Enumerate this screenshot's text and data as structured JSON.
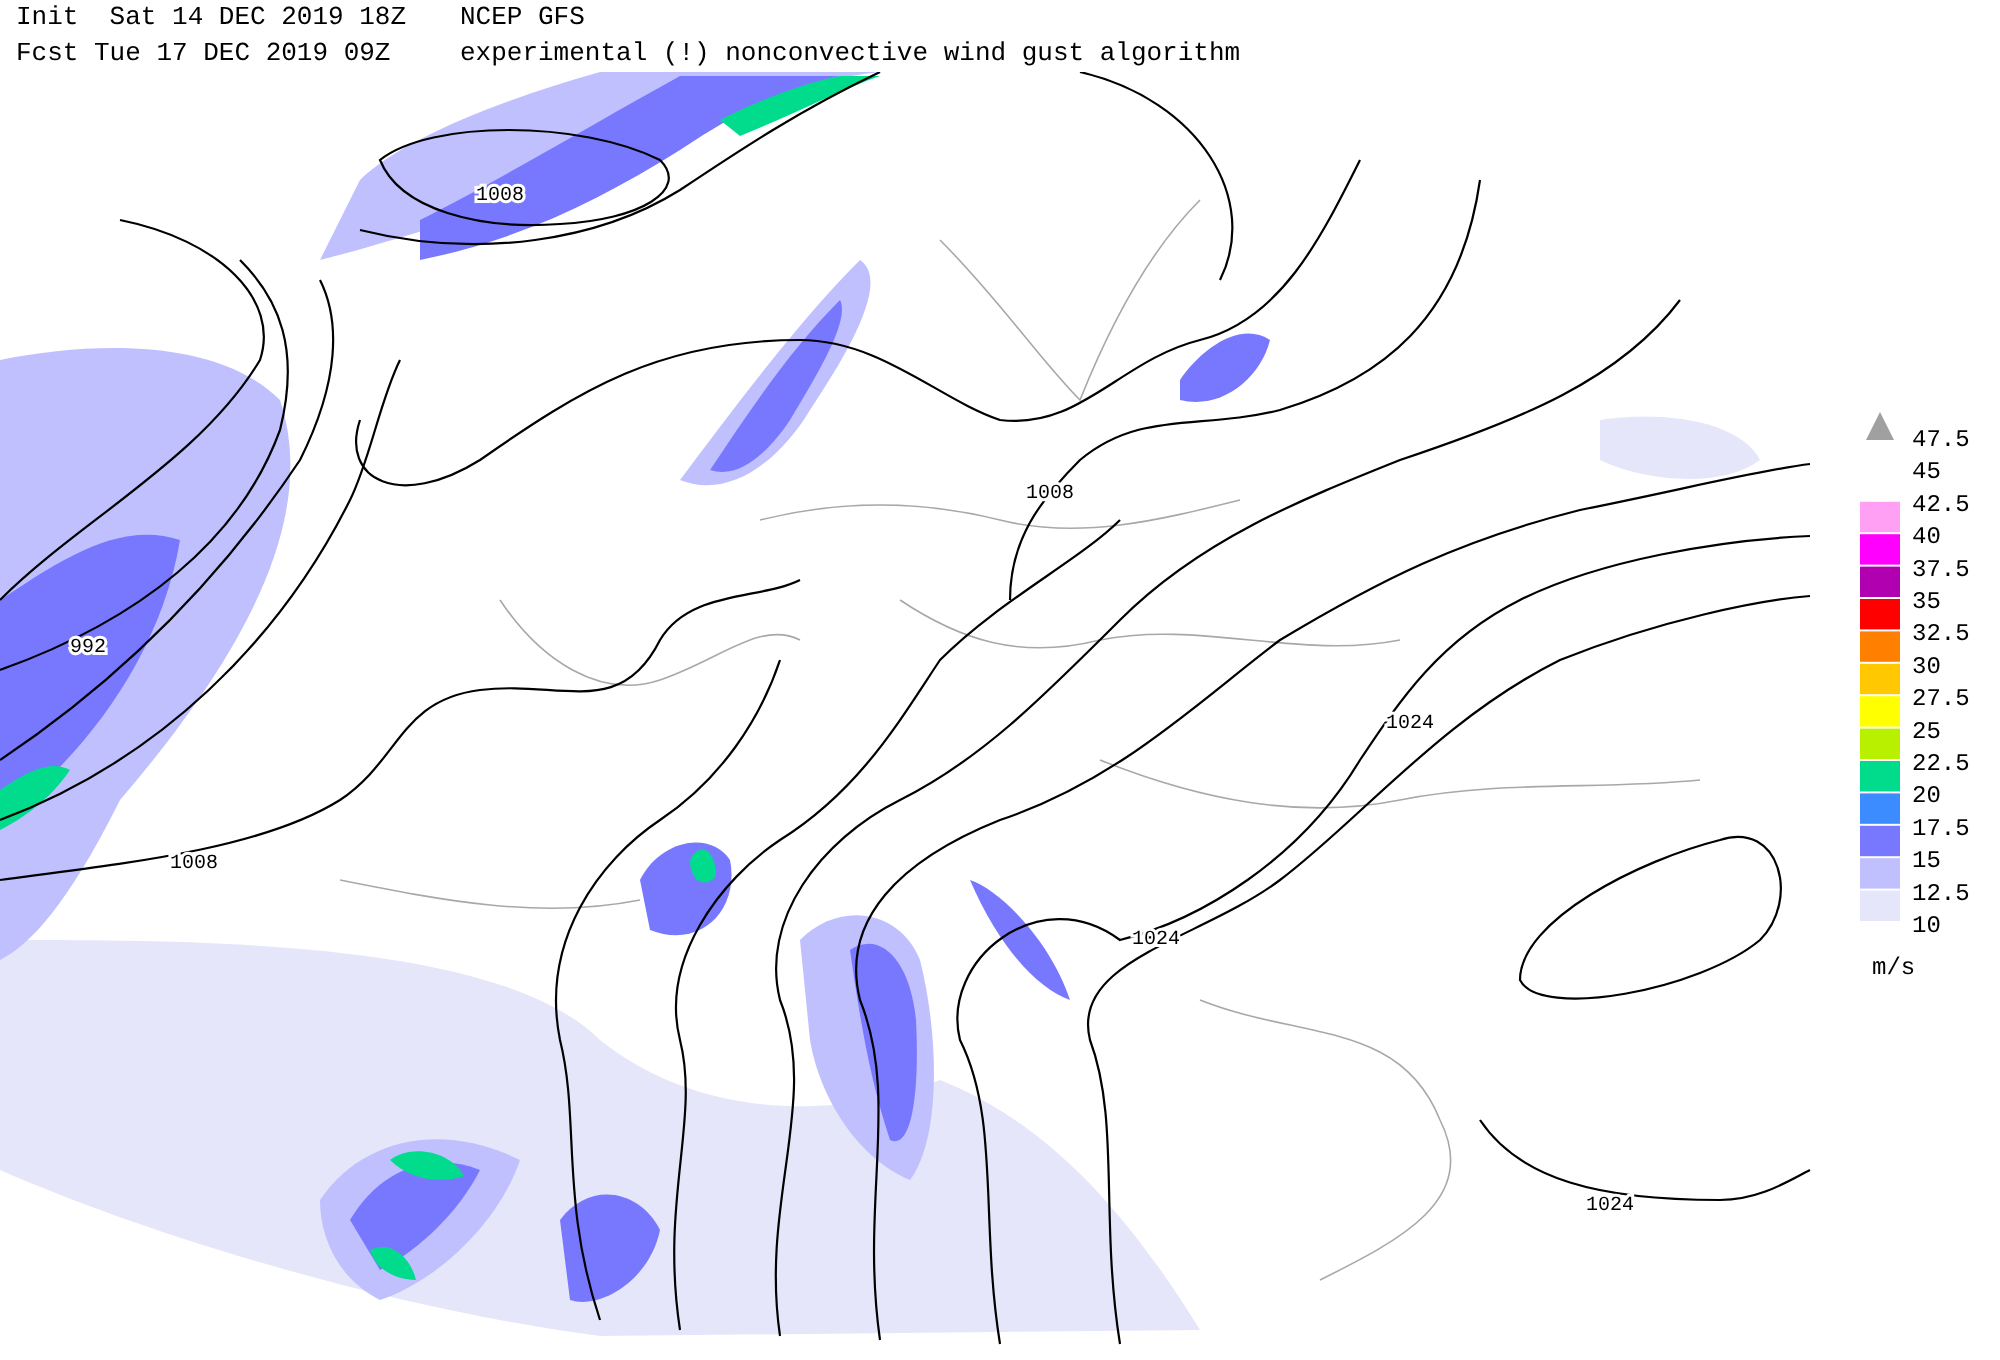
{
  "header": {
    "init": "Init  Sat 14 DEC 2019 18Z",
    "model": "NCEP GFS",
    "forecast": "Fcst Tue 17 DEC 2019 09Z",
    "product": "experimental (!) nonconvective wind gust algorithm"
  },
  "map": {
    "contour_labels": [
      "1008",
      "992",
      "1008",
      "1008",
      "1024",
      "1024",
      "1024"
    ]
  },
  "legend": {
    "labels": [
      "47.5",
      "45",
      "42.5",
      "40",
      "37.5",
      "35",
      "32.5",
      "30",
      "27.5",
      "25",
      "22.5",
      "20",
      "17.5",
      "15",
      "12.5",
      "10"
    ],
    "bins": [
      {
        "color": "#ffa0f5"
      },
      {
        "color": "#ff00ff"
      },
      {
        "color": "#b000b0"
      },
      {
        "color": "#ff0000"
      },
      {
        "color": "#ff8000"
      },
      {
        "color": "#ffc800"
      },
      {
        "color": "#ffff00"
      },
      {
        "color": "#b8f000"
      },
      {
        "color": "#00dc8c"
      },
      {
        "color": "#3c8cff"
      },
      {
        "color": "#7878ff"
      },
      {
        "color": "#c0c0ff"
      },
      {
        "color": "#e6e6fa"
      }
    ],
    "unit": "m/s"
  }
}
